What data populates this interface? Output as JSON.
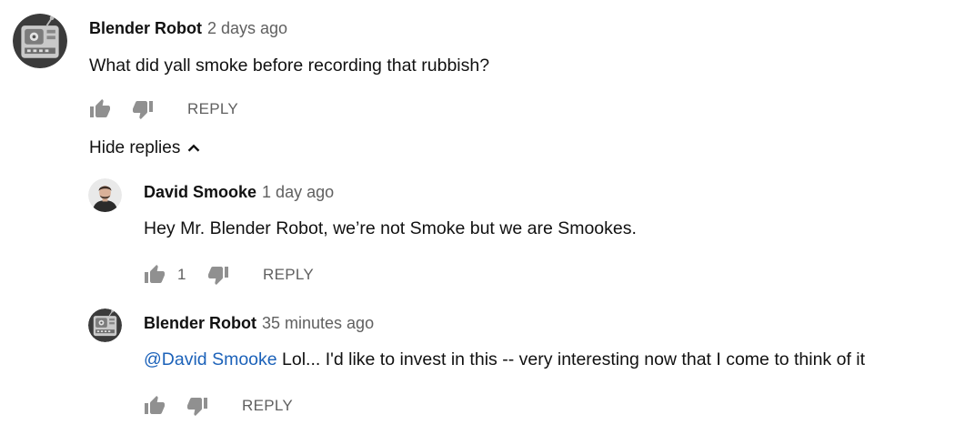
{
  "comment": {
    "author": "Blender Robot",
    "time": "2 days ago",
    "text": "What did yall smoke before recording that rubbish?",
    "reply_label": "REPLY",
    "like_count": ""
  },
  "hide_replies_label": "Hide replies",
  "replies": [
    {
      "author": "David Smooke",
      "time": "1 day ago",
      "text": "Hey Mr. Blender Robot, we’re not Smoke but we are Smookes.",
      "like_count": "1",
      "reply_label": "REPLY"
    },
    {
      "author": "Blender Robot",
      "time": "35 minutes ago",
      "mention": "@David Smooke",
      "text": " Lol... I'd like to invest in this -- very interesting now that I come to think of it",
      "reply_label": "REPLY"
    }
  ],
  "icons": {
    "like": "thumb-up-icon",
    "dislike": "thumb-down-icon",
    "chevron": "chevron-up-icon"
  },
  "colors": {
    "text": "#111111",
    "secondary": "#606060",
    "mention": "#1c62b9",
    "icon": "#909090"
  }
}
